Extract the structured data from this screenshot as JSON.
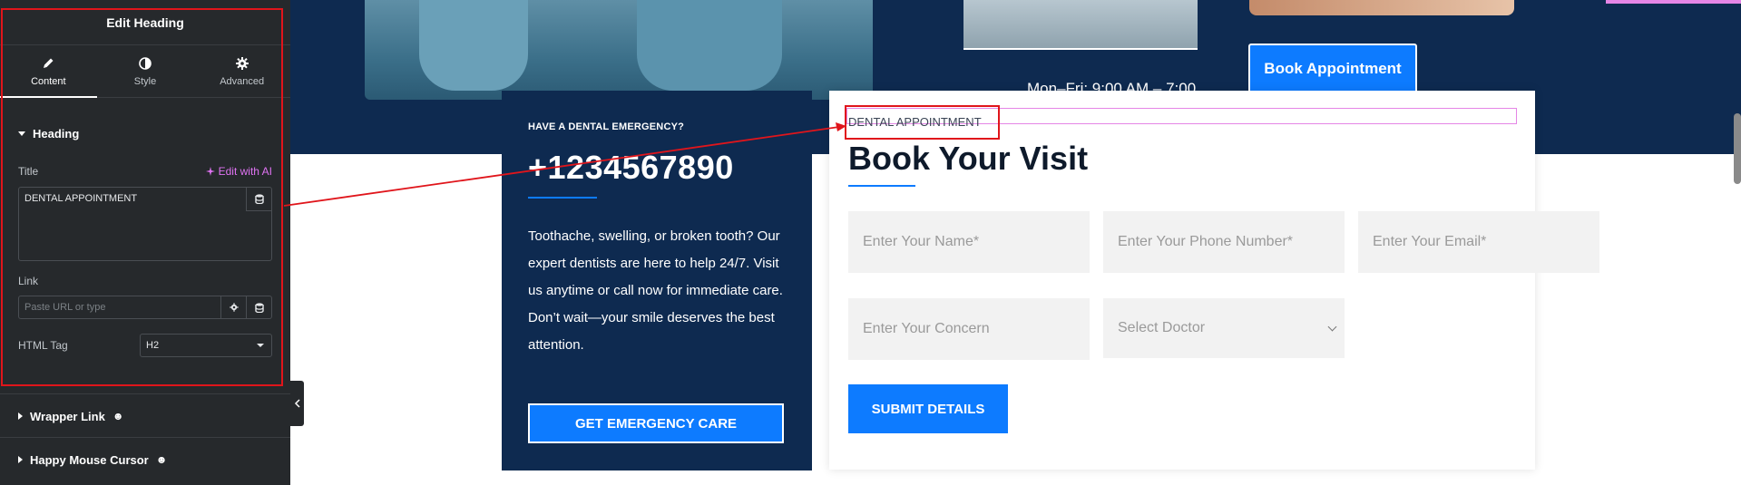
{
  "editor": {
    "title": "Edit Heading",
    "tabs": [
      {
        "label": "Content",
        "icon": "pencil-icon"
      },
      {
        "label": "Style",
        "icon": "half-circle-icon"
      },
      {
        "label": "Advanced",
        "icon": "gear-icon"
      }
    ],
    "heading_section": "Heading",
    "title_label": "Title",
    "edit_ai_label": "Edit with AI",
    "title_value": "DENTAL APPOINTMENT",
    "link_label": "Link",
    "link_placeholder": "Paste URL or type",
    "html_tag_label": "HTML Tag",
    "html_tag_value": "H2",
    "wrapper_link": "Wrapper Link",
    "happy_mouse": "Happy Mouse Cursor",
    "happy_emoji": "☻"
  },
  "hero": {
    "hours": "Mon–Fri: 9:00 AM – 7:00",
    "book_button": "Book Appointment"
  },
  "emergency": {
    "kicker": "HAVE A DENTAL EMERGENCY?",
    "phone": "+1234567890",
    "body_1": "Toothache, swelling, or broken tooth? Our expert dentists are here to help 24/7. Visit us anytime or call now for immediate care.",
    "body_2": "Don’t wait—your smile deserves the best attention.",
    "button": "GET EMERGENCY CARE"
  },
  "form": {
    "kicker": "DENTAL APPOINTMENT",
    "title": "Book Your Visit",
    "name_placeholder": "Enter Your Name*",
    "phone_placeholder": "Enter Your Phone Number*",
    "email_placeholder": "Enter Your Email*",
    "concern_placeholder": "Enter Your Concern",
    "doctor_select": "Select Doctor",
    "submit": "SUBMIT DETAILS"
  },
  "colors": {
    "panel_bg": "#26292c",
    "navy": "#0e2a50",
    "accent_blue": "#0d7bff",
    "highlight_red": "#e0151b",
    "ai_pink": "#e073f3"
  }
}
